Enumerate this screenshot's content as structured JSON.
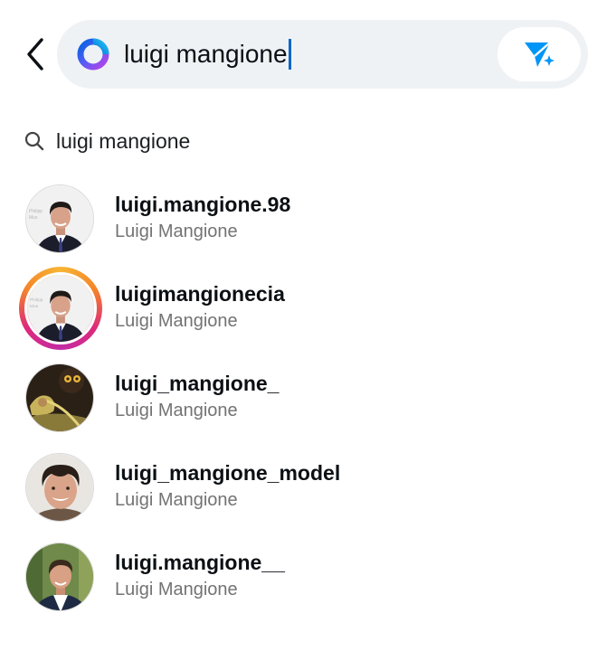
{
  "search": {
    "query": "luigi mangione",
    "back_icon": "chevron-left-icon",
    "ai_icon": "meta-ai-ring-icon",
    "filter_icon": "paper-plane-sparkle-icon"
  },
  "suggestion": {
    "icon": "search-icon",
    "text": "luigi mangione"
  },
  "results": [
    {
      "username": "luigi.mangione.98",
      "name": "Luigi Mangione",
      "avatar": "suit-portrait",
      "story_ring": false
    },
    {
      "username": "luigimangionecia",
      "name": "Luigi Mangione",
      "avatar": "suit-portrait",
      "story_ring": true
    },
    {
      "username": "luigi_mangione_",
      "name": "Luigi Mangione",
      "avatar": "dark-artwork",
      "story_ring": false
    },
    {
      "username": "luigi_mangione_model",
      "name": "Luigi Mangione",
      "avatar": "smiling-portrait",
      "story_ring": false
    },
    {
      "username": "luigi.mangione__",
      "name": "Luigi Mangione",
      "avatar": "outdoor-portrait",
      "story_ring": false
    }
  ],
  "colors": {
    "accent": "#0a66c9",
    "filter_icon": "#0095f6",
    "muted_text": "#737373",
    "search_bg": "#eff2f5"
  }
}
